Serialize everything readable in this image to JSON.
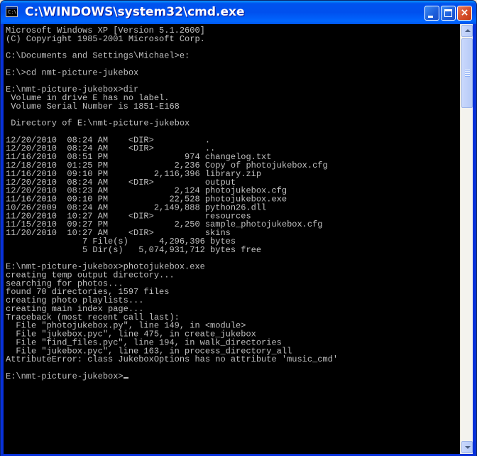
{
  "window": {
    "title": "C:\\WINDOWS\\system32\\cmd.exe",
    "icon_text": "C:\\",
    "icon": "console-icon",
    "controls": {
      "minimize": "minimize-icon",
      "maximize": "maximize-icon",
      "close": "×"
    }
  },
  "colors": {
    "console_background": "#000000",
    "console_text": "#C0C0C0",
    "titlebar": "#0054E3",
    "close_button": "#D44A26"
  },
  "console": {
    "lines": [
      "Microsoft Windows XP [Version 5.1.2600]",
      "(C) Copyright 1985-2001 Microsoft Corp.",
      "",
      "C:\\Documents and Settings\\Michael>e:",
      "",
      "E:\\>cd nmt-picture-jukebox",
      "",
      "E:\\nmt-picture-jukebox>dir",
      " Volume in drive E has no label.",
      " Volume Serial Number is 1851-E168",
      "",
      " Directory of E:\\nmt-picture-jukebox",
      "",
      "12/20/2010  08:24 AM    <DIR>          .",
      "12/20/2010  08:24 AM    <DIR>          ..",
      "11/16/2010  08:51 PM               974 changelog.txt",
      "12/18/2010  01:25 PM             2,236 Copy of photojukebox.cfg",
      "11/16/2010  09:10 PM         2,116,396 library.zip",
      "12/20/2010  08:24 AM    <DIR>          output",
      "12/20/2010  08:23 AM             2,124 photojukebox.cfg",
      "11/16/2010  09:10 PM            22,528 photojukebox.exe",
      "10/26/2009  08:24 AM         2,149,888 python26.dll",
      "11/20/2010  10:27 AM    <DIR>          resources",
      "11/15/2010  09:27 PM             2,250 sample_photojukebox.cfg",
      "11/20/2010  10:27 AM    <DIR>          skins",
      "               7 File(s)      4,296,396 bytes",
      "               5 Dir(s)   5,074,931,712 bytes free",
      "",
      "E:\\nmt-picture-jukebox>photojukebox.exe",
      "creating temp output directory...",
      "searching for photos...",
      "found 70 directories, 1597 files",
      "creating photo playlists...",
      "creating main index page...",
      "Traceback (most recent call last):",
      "  File \"photojukebox.py\", line 149, in <module>",
      "  File \"jukebox.pyc\", line 475, in create_jukebox",
      "  File \"find_files.pyc\", line 194, in walk_directories",
      "  File \"jukebox.pyc\", line 163, in process_directory_all",
      "AttributeError: class JukeboxOptions has no attribute 'music_cmd'",
      ""
    ],
    "prompt": "E:\\nmt-picture-jukebox>"
  },
  "scrollbar": {
    "up_icon": "scroll-up-arrow-icon",
    "down_icon": "scroll-down-arrow-icon",
    "thumb_grip_icon": "grip-icon"
  }
}
